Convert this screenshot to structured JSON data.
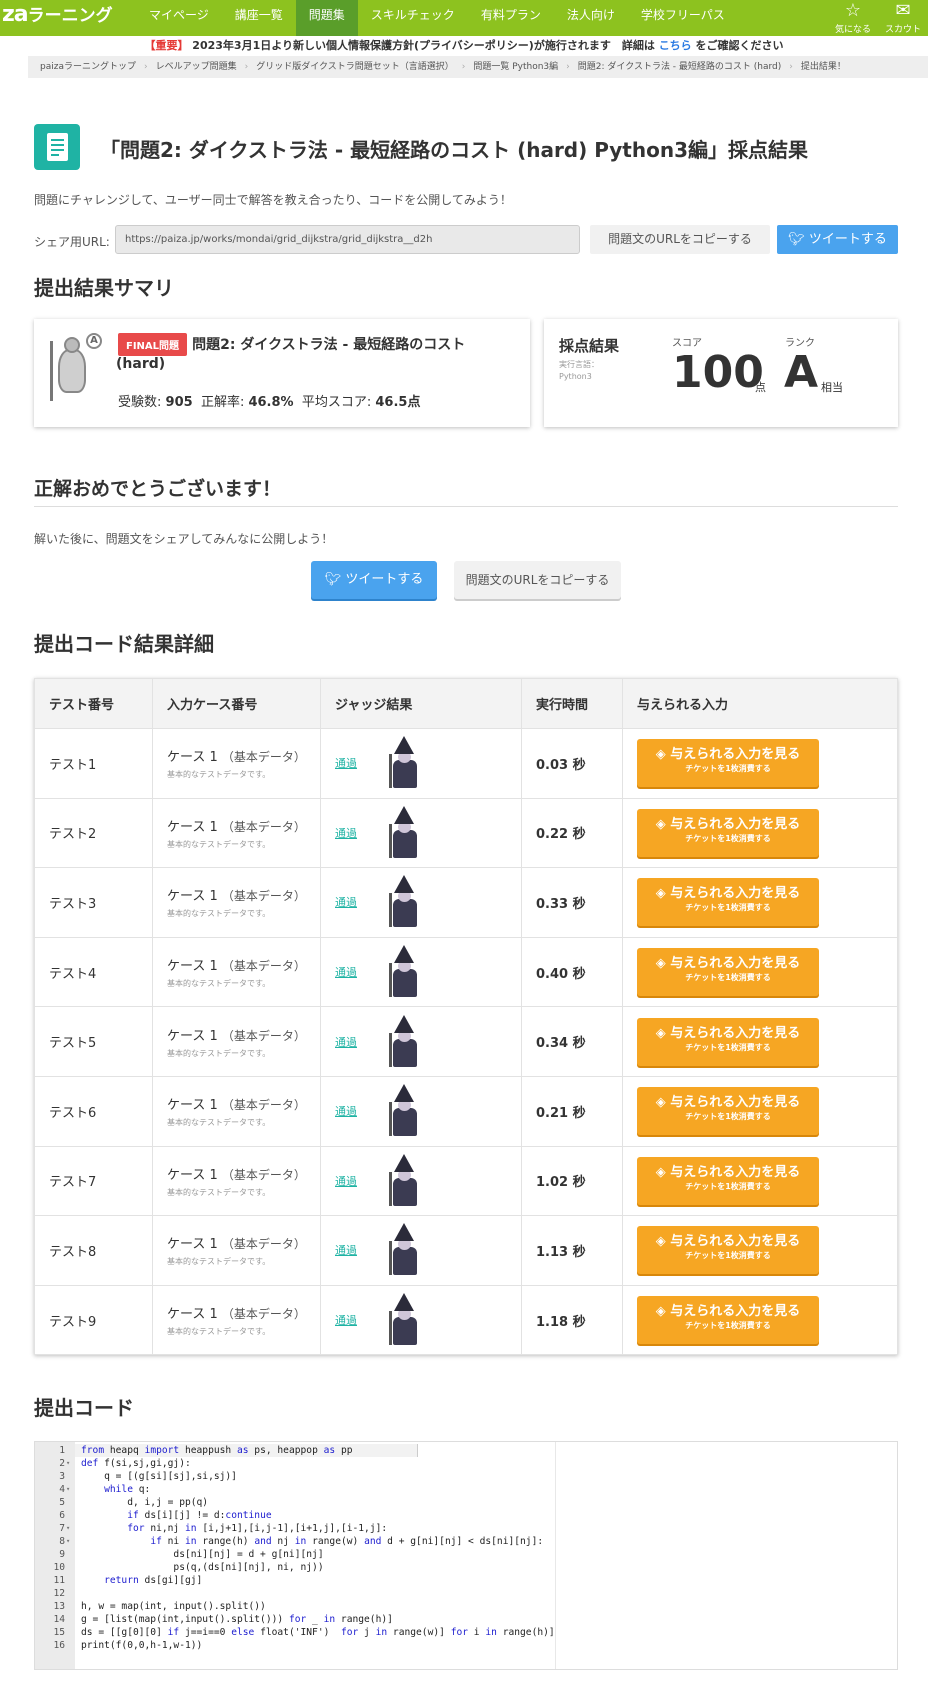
{
  "header": {
    "logo_main": "za",
    "logo_sub": "ラーニング",
    "nav": [
      "マイページ",
      "講座一覧",
      "問題集",
      "スキルチェック",
      "有料プラン",
      "法人向け",
      "学校フリーパス"
    ],
    "active_nav_index": 2,
    "icons": [
      {
        "name": "star-icon",
        "glyph": "☆",
        "label": "気になる"
      },
      {
        "name": "mail-icon",
        "glyph": "✉",
        "label": "スカウト"
      }
    ],
    "brand_color": "#8dc21f"
  },
  "notice": {
    "tag": "【重要】",
    "text": "2023年3月1日より新しい個人情報保護方針(プライバシーポリシー)が施行されます　詳細は",
    "link": "こちら",
    "suffix": "をご確認ください"
  },
  "breadcrumb": [
    "paizaラーニングトップ",
    "レベルアップ問題集",
    "グリッド版ダイクストラ問題セット（言語選択）",
    "問題一覧 Python3編",
    "問題2: ダイクストラ法 - 最短経路のコスト (hard)",
    "提出結果！"
  ],
  "page": {
    "title": "「問題2: ダイクストラ法 - 最短経路のコスト (hard) Python3編」採点結果",
    "lead": "問題にチャレンジして、ユーザー同士で解答を教え合ったり、コードを公開してみよう！",
    "share_label": "シェア用URL:",
    "share_url": "https://paiza.jp/works/mondai/grid_dijkstra/grid_dijkstra__d2h",
    "copy_url_button": "問題文のURLをコピーする",
    "tweet_button": "ツイートする"
  },
  "summary": {
    "heading": "提出結果サマリ",
    "badge": "FINAL問題",
    "problem_name": "問題2: ダイクストラ法 - 最短経路のコスト",
    "problem_name_2": "(hard)",
    "examinees_label": "受験数:",
    "examinees": "905",
    "accuracy_label": "正解率:",
    "accuracy": "46.8%",
    "avg_label": "平均スコア:",
    "avg_score": "46.5点",
    "result_label": "採点結果",
    "lang_label": "実行言語：",
    "lang": "Python3",
    "score_label": "スコア",
    "score": "100",
    "score_unit": "点",
    "rank_label": "ランク",
    "rank": "A",
    "rank_unit": "相当"
  },
  "congrats": {
    "heading": "正解おめでとうございます！",
    "text": "解いた後に、問題文をシェアしてみんなに公開しよう！",
    "tweet_button": "ツイートする",
    "copy_button": "問題文のURLをコピーする"
  },
  "details": {
    "heading": "提出コード結果詳細",
    "columns": [
      "テスト番号",
      "入力ケース番号",
      "ジャッジ結果",
      "実行時間",
      "与えられる入力"
    ],
    "case_label": "ケース 1",
    "case_kind": "（基本データ）",
    "case_desc": "基本的なテストデータです。",
    "judge": "通過",
    "input_button": "与えられる入力を見る",
    "input_button_sub": "チケットを1枚消費する",
    "rows": [
      {
        "test": "テスト1",
        "time": "0.03 秒"
      },
      {
        "test": "テスト2",
        "time": "0.22 秒"
      },
      {
        "test": "テスト3",
        "time": "0.33 秒"
      },
      {
        "test": "テスト4",
        "time": "0.40 秒"
      },
      {
        "test": "テスト5",
        "time": "0.34 秒"
      },
      {
        "test": "テスト6",
        "time": "0.21 秒"
      },
      {
        "test": "テスト7",
        "time": "1.02 秒"
      },
      {
        "test": "テスト8",
        "time": "1.13 秒"
      },
      {
        "test": "テスト9",
        "time": "1.18 秒"
      }
    ]
  },
  "code": {
    "heading": "提出コード",
    "lines": [
      "from heapq import heappush as ps, heappop as pp",
      "def f(si,sj,gi,gj):",
      "    q = [(g[si][sj],si,sj)]",
      "    while q:",
      "        d, i,j = pp(q)",
      "        if ds[i][j] != d:continue",
      "        for ni,nj in [i,j+1],[i,j-1],[i+1,j],[i-1,j]:",
      "            if ni in range(h) and nj in range(w) and d + g[ni][nj] < ds[ni][nj]:",
      "                ds[ni][nj] = d + g[ni][nj]",
      "                ps(q,(ds[ni][nj], ni, nj))",
      "    return ds[gi][gj]",
      "",
      "h, w = map(int, input().split())",
      "g = [list(map(int,input().split())) for _ in range(h)]",
      "ds = [[g[0][0] if j==i==0 else float('INF')  for j in range(w)] for i in range(h)]",
      "print(f(0,0,h-1,w-1))"
    ],
    "folds": [
      2,
      4,
      7,
      8
    ]
  }
}
